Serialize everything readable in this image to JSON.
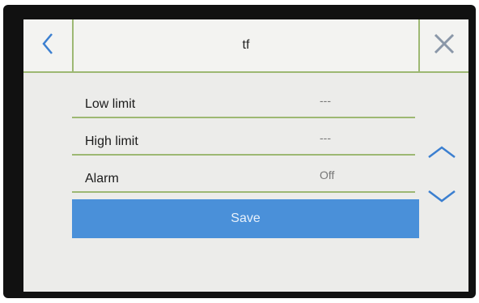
{
  "header": {
    "title": "tf",
    "back_icon": "chevron-left-icon",
    "close_icon": "close-icon"
  },
  "rows": [
    {
      "label": "Low limit",
      "value": "---"
    },
    {
      "label": "High limit",
      "value": "---"
    },
    {
      "label": "Alarm",
      "value": "Off"
    }
  ],
  "save_label": "Save",
  "scroll": {
    "up_icon": "chevron-up-icon",
    "down_icon": "chevron-down-icon"
  },
  "colors": {
    "accent": "#4a90d9",
    "divider": "#9db873",
    "icon": "#3b7fd0",
    "close": "#8a97a8"
  }
}
